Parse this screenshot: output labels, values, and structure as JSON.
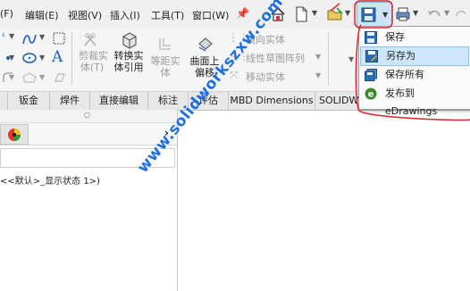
{
  "menu": {
    "file_fragment": "(F)",
    "edit": "编辑(E)",
    "view": "视图(V)",
    "insert": "插入(I)",
    "tools": "工具(T)",
    "window": "窗口(W)"
  },
  "ribbon": {
    "trim_entities": [
      "剪裁实",
      "体(T)"
    ],
    "convert_entities": [
      "转换实",
      "体引用"
    ],
    "equidistant_entities": [
      "等距实",
      "体"
    ],
    "offset_on_surface": [
      "曲面上",
      "偏移"
    ],
    "mirror_entities": "镜向实体",
    "linear_pattern": "线性草图阵列",
    "move_entities": "移动实体"
  },
  "tabs": [
    "钣金",
    "焊件",
    "直接编辑",
    "标注",
    "评估",
    "MBD Dimensions",
    "SOLIDWORKS"
  ],
  "save_menu": {
    "items": [
      {
        "label": "保存",
        "icon": "save-icon"
      },
      {
        "label": "另存为",
        "icon": "save-as-icon"
      },
      {
        "label": "保存所有",
        "icon": "save-all-icon"
      },
      {
        "label": "发布到 eDrawings",
        "icon": "edrawings-icon"
      }
    ]
  },
  "left_panel": {
    "config_text": "<<默认>_显示状态 1>)"
  },
  "watermark": "www.solidworkszxw.com",
  "colors": {
    "annotation_red": "#e0242b",
    "watermark_blue": "#1e6fe0",
    "highlight": "#cde6fb"
  }
}
